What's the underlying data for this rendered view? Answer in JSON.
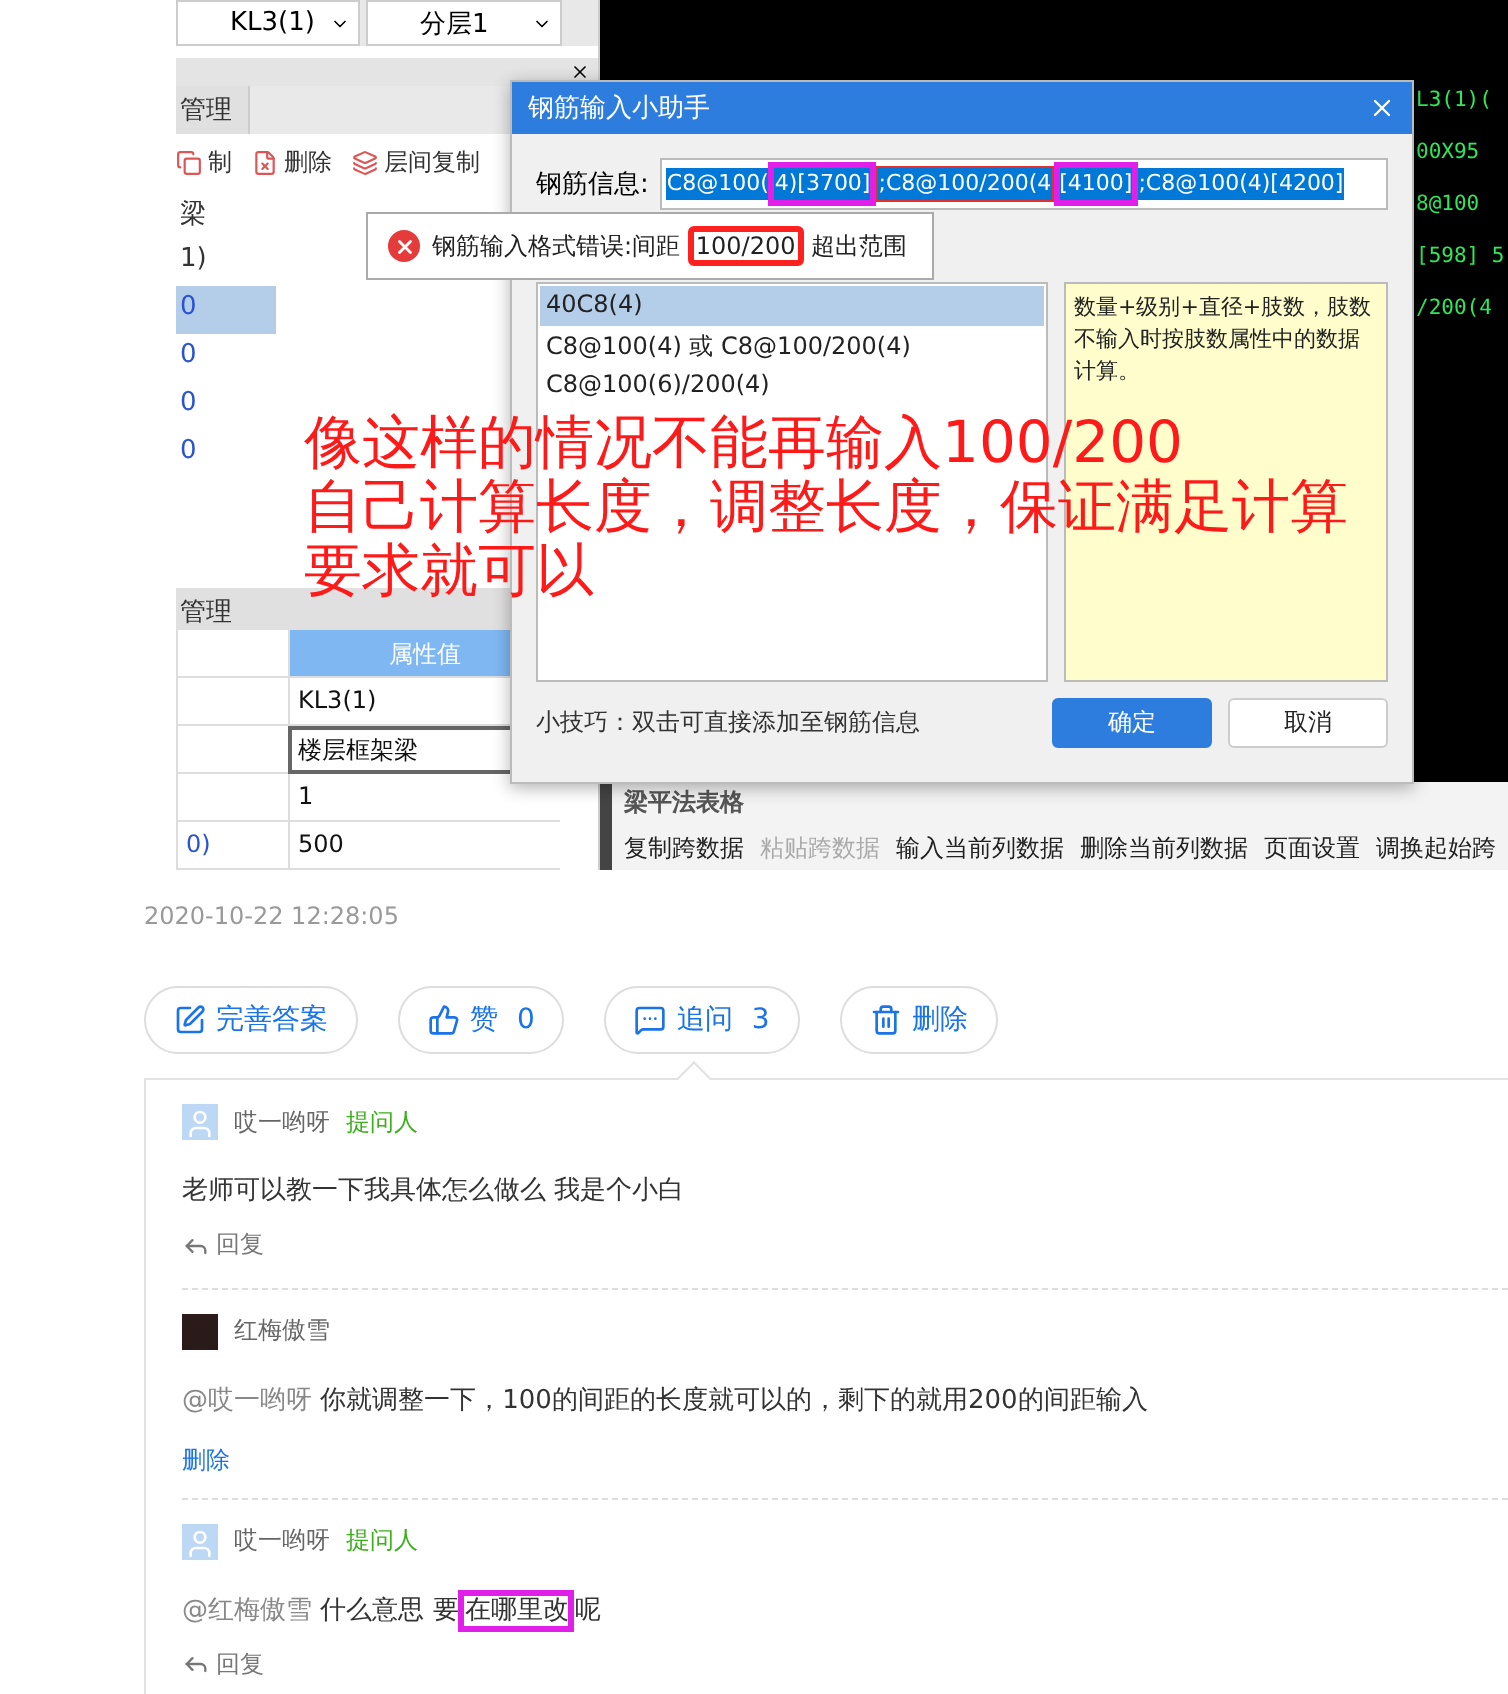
{
  "screenshot": {
    "dropdowns": [
      {
        "value": "KL3(1)"
      },
      {
        "value": "分层1"
      }
    ],
    "left_panel": {
      "tab": "管理",
      "toolbar": [
        {
          "kind": "copy",
          "label": "制"
        },
        {
          "kind": "delete",
          "label": "删除"
        },
        {
          "kind": "floor-copy",
          "label": "层间复制"
        }
      ],
      "list_items": [
        {
          "label": "梁",
          "selected": false
        },
        {
          "label": "1)",
          "selected": false
        },
        {
          "label": "0",
          "selected": true
        },
        {
          "label": "0",
          "selected": false
        },
        {
          "label": "0",
          "selected": false
        },
        {
          "label": "0",
          "selected": false
        }
      ]
    },
    "properties": {
      "tab": "管理",
      "header": "属性值",
      "rows": [
        {
          "value": "KL3(1)",
          "editing": false
        },
        {
          "value": "楼层框架梁",
          "editing": true
        },
        {
          "value": "1",
          "editing": false
        },
        {
          "name": "0)",
          "value": "500",
          "editing": false
        }
      ]
    },
    "canvas": {
      "lines": [
        "L3(1)(",
        "00X95",
        "8@100",
        "[598] 5",
        "/200(4"
      ]
    },
    "table_panel": {
      "title": "梁平法表格",
      "toolbar": [
        {
          "label": "复制跨数据",
          "disabled": false
        },
        {
          "label": "粘贴跨数据",
          "disabled": true
        },
        {
          "label": "输入当前列数据",
          "disabled": false
        },
        {
          "label": "删除当前列数据",
          "disabled": false
        },
        {
          "label": "页面设置",
          "disabled": false
        },
        {
          "label": "调换起始跨",
          "disabled": false
        }
      ]
    },
    "dialog": {
      "title": "钢筋输入小助手",
      "field_label": "钢筋信息:",
      "field_segments": [
        {
          "text": "C8@100(",
          "marked": false,
          "error": false
        },
        {
          "text": "4)[3700]",
          "marked": true,
          "error": false
        },
        {
          "text": ";C8@100/200(4",
          "marked": false,
          "error": true
        },
        {
          "text": "[4100]",
          "marked": true,
          "error": false
        },
        {
          "text": ";C8@100(4)[4200]",
          "marked": false,
          "error": false
        }
      ],
      "options": [
        {
          "label": "40C8(4)",
          "selected": true
        },
        {
          "label": "C8@100(4) 或 C8@100/200(4)",
          "selected": false
        },
        {
          "label": "C8@100(6)/200(4)",
          "selected": false
        }
      ],
      "hint": "数量+级别+直径+肢数，肢数不输入时按肢数属性中的数据计算。",
      "tip": "小技巧：双击可直接添加至钢筋信息",
      "buttons": [
        {
          "label": "确定",
          "primary": true
        },
        {
          "label": "取消",
          "primary": false
        }
      ]
    },
    "error_tooltip": {
      "before": "钢筋输入格式错误:间距",
      "marked": "100/200",
      "after": "超出范围"
    },
    "annotation": {
      "lines": [
        "像这样的情况不能再输入100/200",
        "自己计算长度，调整长度，保证满足计算",
        "要求就可以"
      ]
    }
  },
  "timestamp": "2020-10-22 12:28:05",
  "actions": [
    {
      "kind": "edit",
      "label": "完善答案"
    },
    {
      "kind": "like",
      "label": "赞",
      "count": "0"
    },
    {
      "kind": "comment",
      "label": "追问",
      "count": "3"
    },
    {
      "kind": "delete",
      "label": "删除"
    }
  ],
  "comments": [
    {
      "avatar": {
        "kind": "default"
      },
      "author": "哎一哟呀",
      "role": "提问人",
      "segments": [
        {
          "text": "老师可以教一下我具体怎么做么 我是个小白",
          "marked": false
        }
      ],
      "action": {
        "kind": "reply",
        "label": "回复"
      }
    },
    {
      "avatar": {
        "kind": "photo"
      },
      "author": "红梅傲雪",
      "mention": "@哎一哟呀",
      "segments": [
        {
          "text": "你就调整一下，100的间距的长度就可以的，剩下的就用200的间距输入",
          "marked": false
        }
      ],
      "action": {
        "kind": "delete",
        "label": "删除"
      }
    },
    {
      "avatar": {
        "kind": "default"
      },
      "author": "哎一哟呀",
      "role": "提问人",
      "mention": "@红梅傲雪",
      "segments": [
        {
          "text": "什么意思 要",
          "marked": false
        },
        {
          "text": "在哪里改",
          "marked": true
        },
        {
          "text": "呢",
          "marked": false
        }
      ],
      "action": {
        "kind": "reply",
        "label": "回复"
      }
    }
  ]
}
